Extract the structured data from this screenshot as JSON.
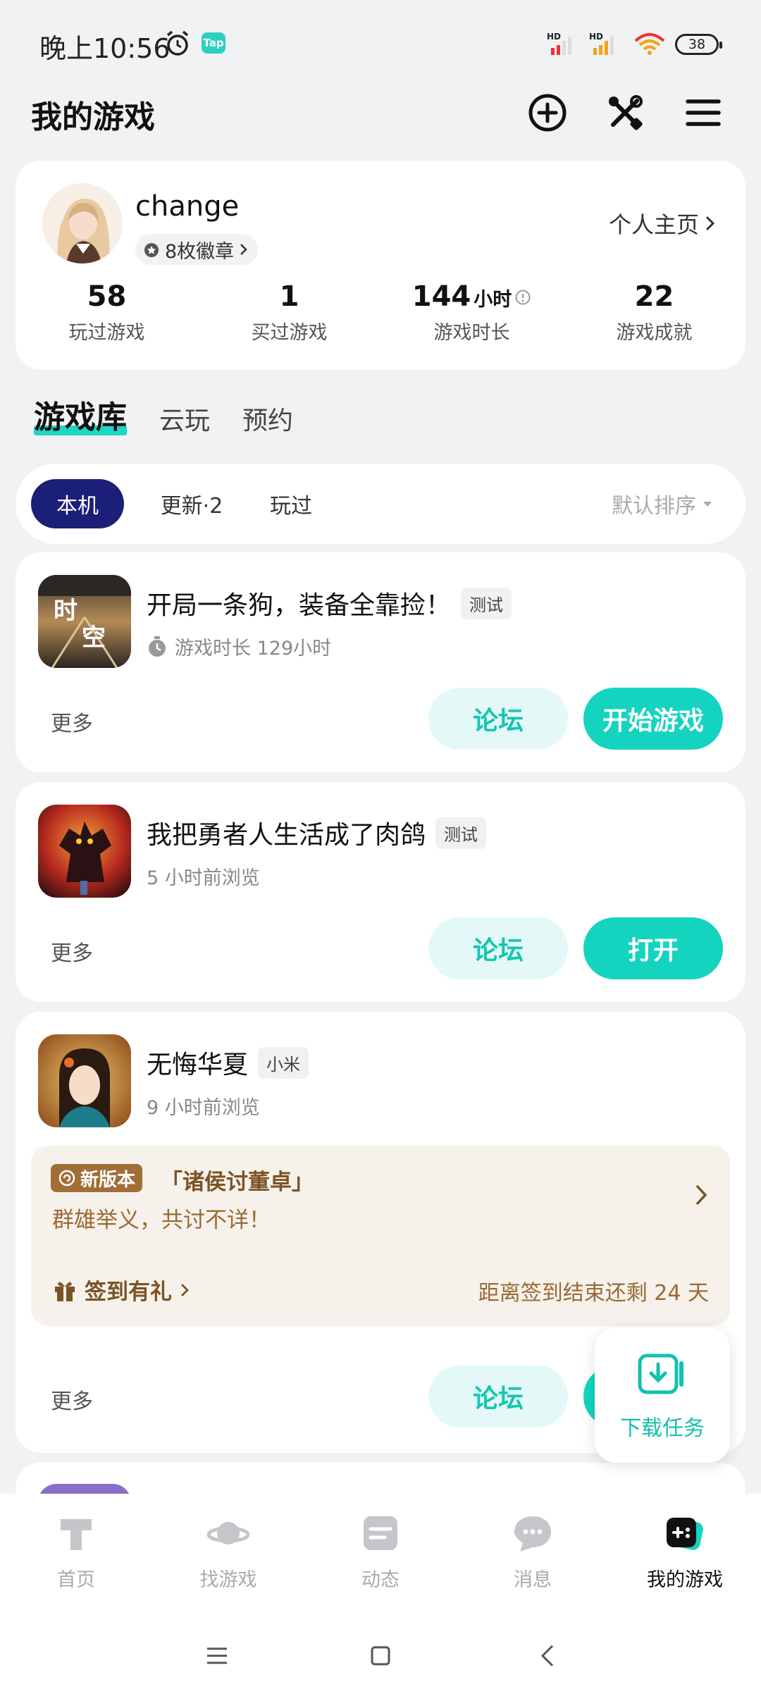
{
  "status": {
    "time": "晚上10:56",
    "tap": "Tap",
    "battery": "38"
  },
  "header": {
    "title": "我的游戏"
  },
  "profile": {
    "username": "change",
    "badges": "8枚徽章",
    "homepage": "个人主页",
    "stats": [
      {
        "value": "58",
        "unit": "",
        "label": "玩过游戏"
      },
      {
        "value": "1",
        "unit": "",
        "label": "买过游戏"
      },
      {
        "value": "144",
        "unit": "小时",
        "label": "游戏时长"
      },
      {
        "value": "22",
        "unit": "",
        "label": "游戏成就"
      }
    ]
  },
  "library_tabs": [
    "游戏库",
    "云玩",
    "预约"
  ],
  "filters": {
    "chips": [
      "本机",
      "更新·2",
      "玩过"
    ],
    "sort": "默认排序"
  },
  "games": [
    {
      "title": "开局一条狗，装备全靠捡！",
      "tag": "测试",
      "sub": "游戏时长 129小时",
      "more": "更多",
      "forum": "论坛",
      "action": "开始游戏",
      "icon_text": [
        "时",
        "空"
      ]
    },
    {
      "title": "我把勇者人生活成了肉鸽",
      "tag": "测试",
      "sub": "5 小时前浏览",
      "more": "更多",
      "forum": "论坛",
      "action": "打开"
    },
    {
      "title": "无悔华夏",
      "tag": "小米",
      "sub": "9 小时前浏览",
      "more": "更多",
      "forum": "论坛",
      "promo": {
        "badge": "新版本",
        "title": "「诸侯讨董卓」",
        "desc": "群雄举义，共讨不详！",
        "sign": "签到有礼",
        "remain": "距离签到结束还剩 24 天"
      }
    }
  ],
  "download": {
    "label": "下载任务"
  },
  "bottom_nav": [
    {
      "label": "首页",
      "icon": "home-icon"
    },
    {
      "label": "找游戏",
      "icon": "planet-icon"
    },
    {
      "label": "动态",
      "icon": "feed-icon"
    },
    {
      "label": "消息",
      "icon": "message-icon"
    },
    {
      "label": "我的游戏",
      "icon": "gamepad-icon",
      "active": true
    }
  ],
  "colors": {
    "accent": "#14d4c0",
    "chip_active": "#1c1f77",
    "promo_bg": "#f6f1eb",
    "promo_text": "#9a6a34"
  }
}
